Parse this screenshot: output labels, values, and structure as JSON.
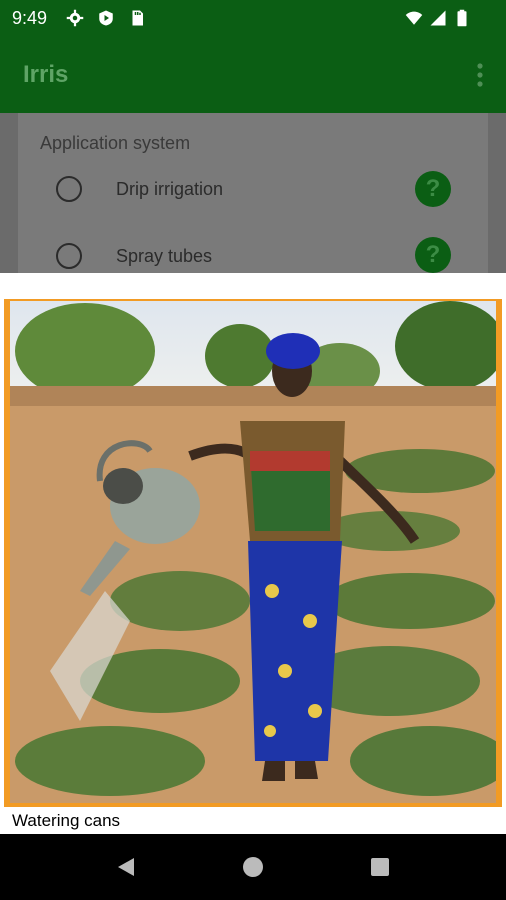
{
  "status": {
    "time": "9:49"
  },
  "app": {
    "title": "Irris"
  },
  "section": {
    "title": "Application system"
  },
  "options": [
    {
      "label": "Drip irrigation",
      "help_icon": "?"
    },
    {
      "label": "Spray tubes",
      "help_icon": "?"
    }
  ],
  "dialog": {
    "caption": "Watering cans"
  },
  "colors": {
    "primary": "#0b5e14",
    "accent_border": "#f29b24"
  }
}
